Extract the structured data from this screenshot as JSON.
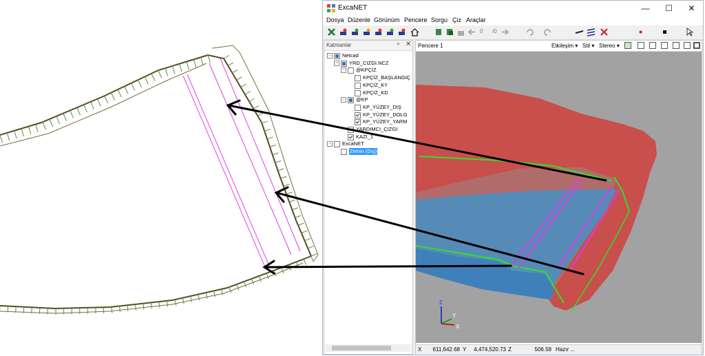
{
  "window": {
    "title": "ExcaNET",
    "minimize_glyph": "—",
    "maximize_glyph": "☐",
    "close_glyph": "✕"
  },
  "menu": [
    "Dosya",
    "Düzenle",
    "Görünüm",
    "Pencere",
    "Sorgu",
    "Çiz",
    "Araçlar"
  ],
  "toolbar": {
    "icons": [
      "close-x-icon",
      "layer-tool-icon",
      "layer-tool-2-icon",
      "layer-tool-3-icon",
      "layer-tool-4-icon",
      "layer-tool-5-icon",
      "layer-tool-6-icon",
      "home-icon",
      "copy-icon",
      "paste-icon",
      "lock-icon",
      "back-arrow-icon",
      "forward-arrow-icon",
      "undo-icon",
      "redo-icon",
      "line-style-icon",
      "multi-line-icon",
      "delete-icon",
      "point-icon",
      "square-point-icon",
      "pointer-icon"
    ],
    "page_current": "0",
    "page_total": "/0"
  },
  "layers_panel": {
    "title": "Katmanlar",
    "pin_glyph": "ᵖ",
    "close_glyph": "✕",
    "tree": [
      {
        "label": "Netcad",
        "level": 0,
        "toggle": "−",
        "check": "part"
      },
      {
        "label": "YRD_CIZGI.NCZ",
        "level": 1,
        "toggle": "−",
        "check": "part"
      },
      {
        "label": "@KPÇİZ",
        "level": 2,
        "toggle": "−",
        "check": "off"
      },
      {
        "label": "KPÇİZ_BAŞLANGIÇ",
        "level": 3,
        "toggle": "",
        "check": "off"
      },
      {
        "label": "KPÇİZ_KY",
        "level": 3,
        "toggle": "",
        "check": "off"
      },
      {
        "label": "KPÇİZ_KD",
        "level": 3,
        "toggle": "",
        "check": "off"
      },
      {
        "label": "@KP",
        "level": 2,
        "toggle": "−",
        "check": "part"
      },
      {
        "label": "KP_YÜZEY_DIŞ",
        "level": 3,
        "toggle": "",
        "check": "off"
      },
      {
        "label": "KP_YÜZEY_DOLG",
        "level": 3,
        "toggle": "",
        "check": "on"
      },
      {
        "label": "KP_YÜZEY_YARM",
        "level": 3,
        "toggle": "",
        "check": "on"
      },
      {
        "label": "YARDIMCI_ÇIZGI",
        "level": 2,
        "toggle": "",
        "check": "on"
      },
      {
        "label": "KAZI_1",
        "level": 2,
        "toggle": "",
        "check": "on"
      },
      {
        "label": "ExcaNET",
        "level": 0,
        "toggle": "−",
        "check": "off"
      },
      {
        "label": "Zemin (Dış)",
        "level": 1,
        "toggle": "",
        "check": "off",
        "selected": true
      }
    ]
  },
  "viewport": {
    "title": "Pencere 1",
    "etkilesim": "Etkileşim",
    "stil": "Stil",
    "stereo": "Stereo",
    "dropdown_glyph": "▾",
    "axes": {
      "x": "X",
      "y": "Y",
      "z": "Z"
    },
    "colors": {
      "background": "#a2a2a2",
      "red_surface": "#c84f4b",
      "blue_surface": "#4d8fc1",
      "green_edge": "#2fe02f",
      "magenta_edge": "#d23fe0"
    }
  },
  "status": {
    "x_label": "X",
    "x_value": "611,642.68",
    "y_label": "Y",
    "y_value": "4,474,520.73",
    "z_label": "Z",
    "z_value": "506.58",
    "state": "Hazır ..."
  },
  "drawing": {
    "line_color": "#5a4a1e",
    "tick_color": "#4f8f4f",
    "magenta": "#e040e0",
    "arrow_color": "#000000"
  }
}
